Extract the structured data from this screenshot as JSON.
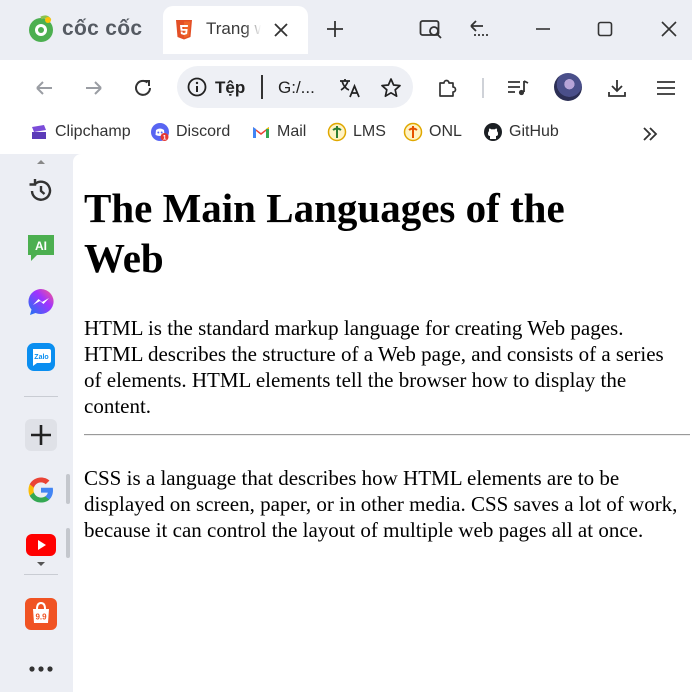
{
  "browser": {
    "brand_name": "cốc cốc",
    "tab": {
      "title": "Trang web"
    },
    "omnibox": {
      "scheme_label": "Tệp",
      "url": "G:/..."
    }
  },
  "bookmarks": [
    {
      "label": "Clipchamp",
      "icon": "clipchamp-icon"
    },
    {
      "label": "Discord",
      "icon": "discord-icon",
      "badge": "1"
    },
    {
      "label": "Mail",
      "icon": "gmail-icon"
    },
    {
      "label": "LMS",
      "icon": "lms-icon"
    },
    {
      "label": "ONL",
      "icon": "onl-icon"
    },
    {
      "label": "GitHub",
      "icon": "github-icon"
    }
  ],
  "sidebar": {
    "items": [
      "history-icon",
      "ai-chat-icon",
      "messenger-icon",
      "zalo-icon",
      "add-icon",
      "google-icon",
      "youtube-icon",
      "shopee-icon",
      "more-icon"
    ],
    "ai_label": "AI",
    "zalo_label": "Zalo",
    "shopee_label": "9.9"
  },
  "page": {
    "heading": "The Main Languages of the Web",
    "paragraph1": "HTML is the standard markup language for creating Web pages. HTML describes the structure of a Web page, and consists of a series of elements. HTML elements tell the browser how to display the content.",
    "paragraph2": "CSS is a language that describes how HTML elements are to be displayed on screen, paper, or in other media. CSS saves a lot of work, because it can control the layout of multiple web pages all at once."
  },
  "colors": {
    "chrome_bg": "#eceef4",
    "coccoc_green": "#4caf50",
    "html5_orange": "#e34f26"
  }
}
